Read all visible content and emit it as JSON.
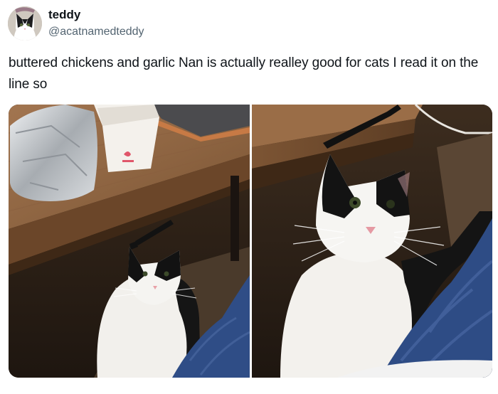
{
  "author": {
    "display_name": "teddy",
    "handle": "@acatnamedteddy",
    "avatar_icon": "cat-avatar-icon"
  },
  "post": {
    "text": "buttered chickens and garlic Nan is actually realley good for cats I read it on the line so"
  },
  "media": {
    "count": 2,
    "photos": [
      {
        "name": "photo-cat-under-table-wide"
      },
      {
        "name": "photo-cat-closeup"
      }
    ]
  },
  "colors": {
    "text_primary": "#0f1419",
    "text_secondary": "#536471",
    "background": "#ffffff"
  }
}
